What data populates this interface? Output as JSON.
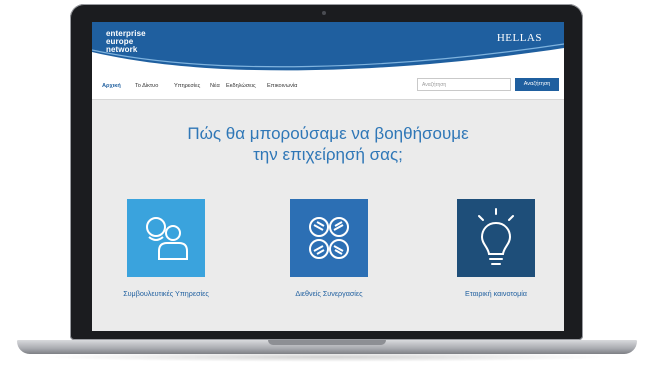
{
  "site": {
    "logo_lines": [
      "enterprise",
      "europe",
      "network"
    ],
    "region": "HELLAS"
  },
  "nav": {
    "items": [
      {
        "label": "Αρχική",
        "active": true
      },
      {
        "label": "Το Δίκτυο",
        "active": false
      },
      {
        "label": "Υπηρεσίες",
        "active": false
      },
      {
        "label": "Νέα",
        "active": false
      },
      {
        "label": "Εκδηλώσεις",
        "active": false
      },
      {
        "label": "Επικοινωνία",
        "active": false
      }
    ],
    "search_placeholder": "Αναζήτηση",
    "search_button": "Αναζήτηση"
  },
  "main": {
    "headline_line1": "Πώς θα μπορούσαμε να βοηθήσουμε",
    "headline_line2": "την επιχείρησή σας;",
    "services": [
      {
        "label": "Συμβουλευτικές Υπηρεσίες",
        "icon": "consulting-people-icon",
        "color": "#3aa3dd"
      },
      {
        "label": "Διεθνείς Συνεργασίες",
        "icon": "handshake-icon",
        "color": "#2c6fb4"
      },
      {
        "label": "Εταιρική καινοτομία",
        "icon": "lightbulb-icon",
        "color": "#1e4e79"
      }
    ]
  },
  "colors": {
    "brand": "#1f5f9f",
    "headline": "#2f77b7"
  }
}
